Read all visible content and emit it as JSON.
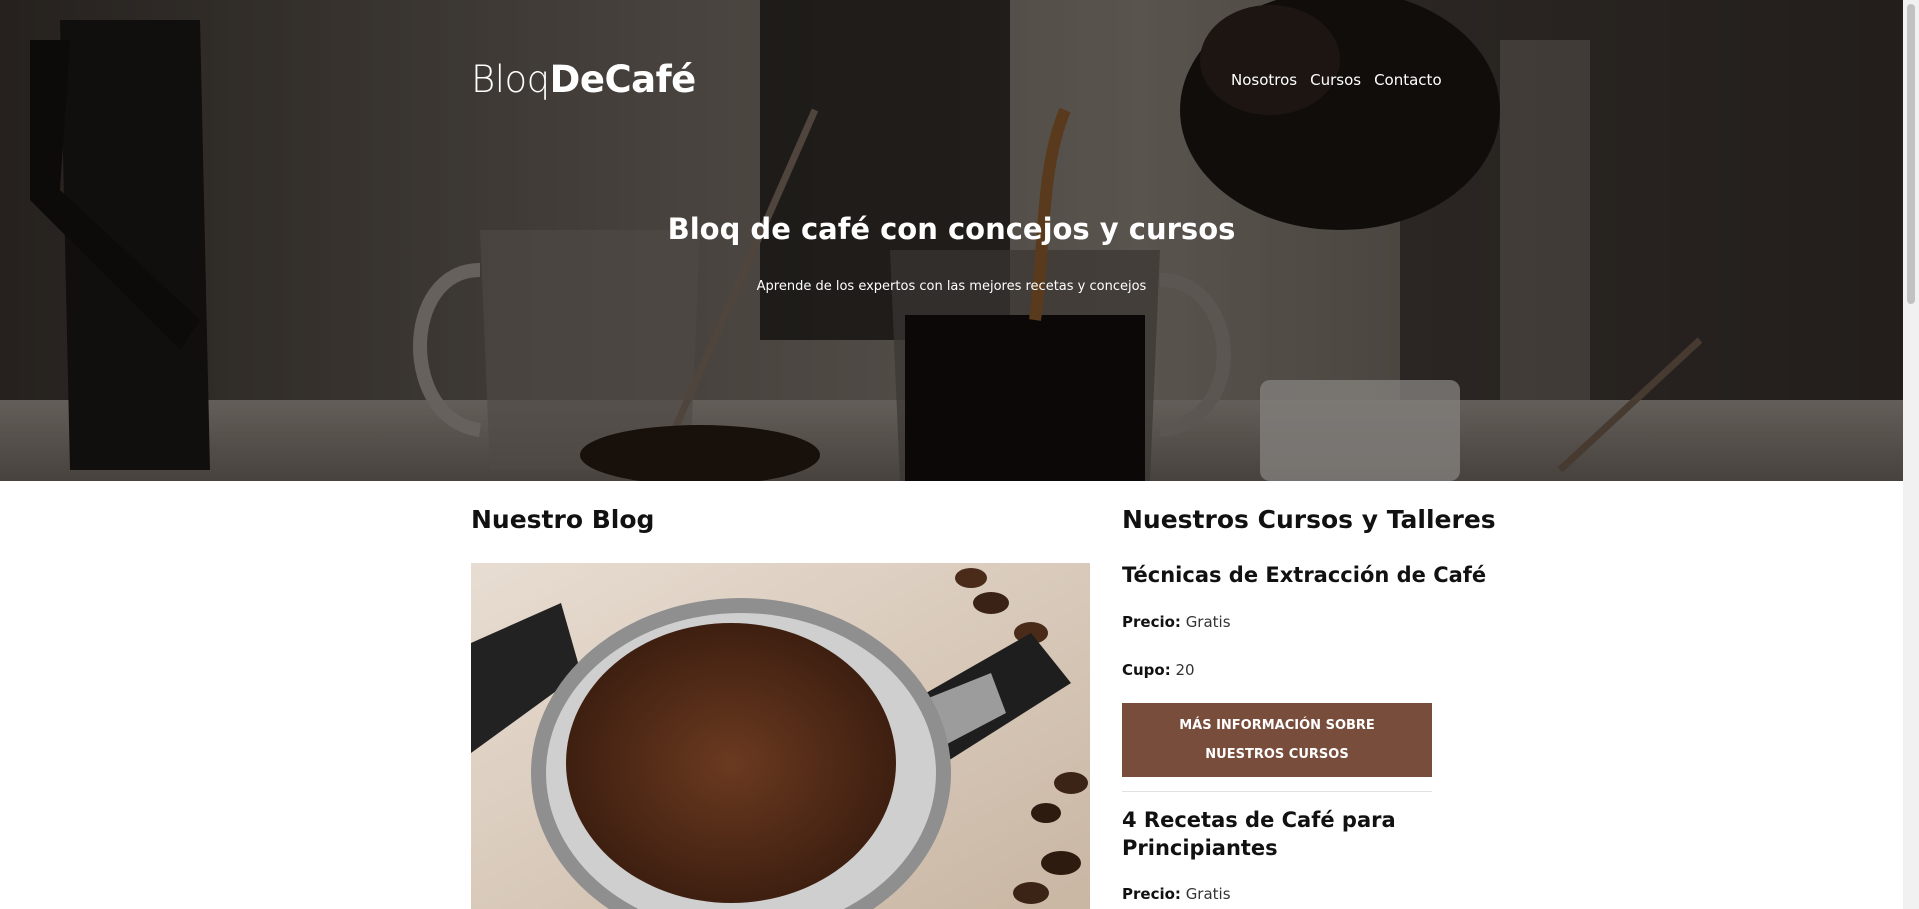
{
  "header": {
    "logo_light": "Bloq",
    "logo_bold": "DeCafé",
    "nav": [
      "Nosotros",
      "Cursos",
      "Contacto"
    ]
  },
  "hero": {
    "title": "Bloq de café con concejos y cursos",
    "subtitle": "Aprende de los expertos con las mejores recetas y concejos"
  },
  "blog": {
    "title": "Nuestro Blog"
  },
  "courses": {
    "title": "Nuestros Cursos y Talleres",
    "items": [
      {
        "title": "Técnicas de Extracción de Café",
        "price_label": "Precio:",
        "price_value": "Gratis",
        "seats_label": "Cupo:",
        "seats_value": "20",
        "button_label": "Más información sobre nuestros cursos"
      },
      {
        "title": "4 Recetas de Café para Principiantes",
        "price_label": "Precio:",
        "price_value": "Gratis"
      }
    ]
  },
  "colors": {
    "button": "#784d3c",
    "hero_overlay": "rgba(0,0,0,0.35)"
  }
}
